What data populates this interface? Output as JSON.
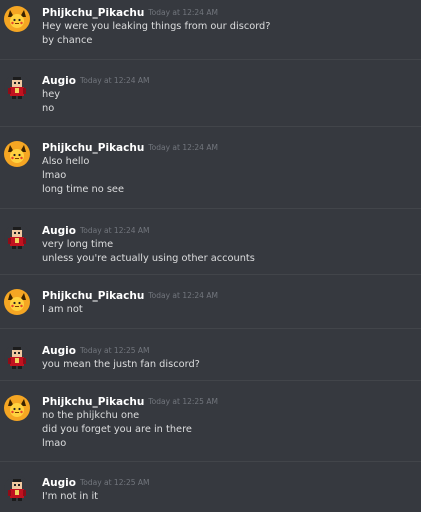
{
  "colors": {
    "background": "#36393f",
    "username": "#ffffff",
    "timestamp": "#72767d",
    "message_text": "#dcddde",
    "divider": "#42454a",
    "pikachu_avatar_bg": "#f5a623",
    "augio_avatar_red": "#c1121f"
  },
  "messages": [
    {
      "avatar_icon": "pikachu-avatar-icon",
      "username": "Phijkchu_Pikachu",
      "timestamp": "Today at 12:24 AM",
      "lines": [
        "Hey were you leaking things from our discord?",
        "by chance"
      ]
    },
    {
      "avatar_icon": "augio-avatar-icon",
      "username": "Augio",
      "timestamp": "Today at 12:24 AM",
      "lines": [
        "hey",
        "no"
      ]
    },
    {
      "avatar_icon": "pikachu-avatar-icon",
      "username": "Phijkchu_Pikachu",
      "timestamp": "Today at 12:24 AM",
      "lines": [
        "Also hello",
        "lmao",
        "long time no see"
      ]
    },
    {
      "avatar_icon": "augio-avatar-icon",
      "username": "Augio",
      "timestamp": "Today at 12:24 AM",
      "lines": [
        "very long time",
        "unless you're actually using other accounts"
      ]
    },
    {
      "avatar_icon": "pikachu-avatar-icon",
      "username": "Phijkchu_Pikachu",
      "timestamp": "Today at 12:24 AM",
      "lines": [
        "I am not"
      ]
    },
    {
      "avatar_icon": "augio-avatar-icon",
      "username": "Augio",
      "timestamp": "Today at 12:25 AM",
      "lines": [
        "you mean the justn fan discord?"
      ]
    },
    {
      "avatar_icon": "pikachu-avatar-icon",
      "username": "Phijkchu_Pikachu",
      "timestamp": "Today at 12:25 AM",
      "lines": [
        "no the phijkchu one",
        "did you forget you are in there",
        "lmao"
      ]
    },
    {
      "avatar_icon": "augio-avatar-icon",
      "username": "Augio",
      "timestamp": "Today at 12:25 AM",
      "lines": [
        "I'm not in it"
      ]
    }
  ]
}
